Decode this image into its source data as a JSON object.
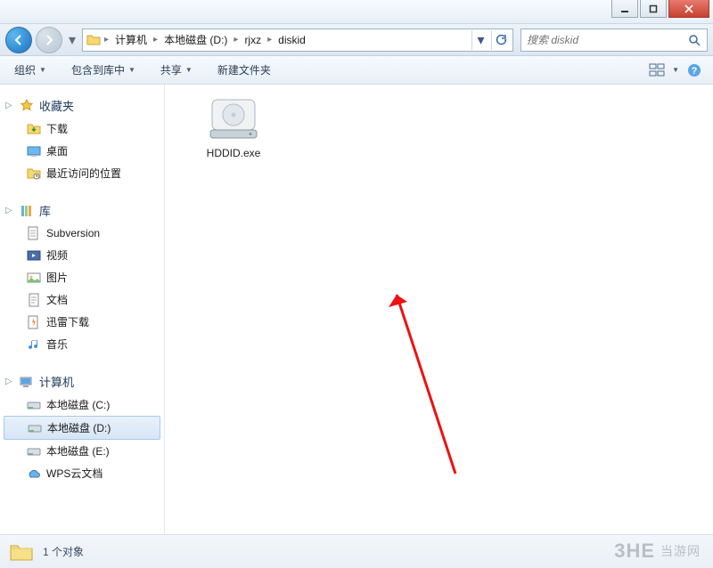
{
  "windowControls": {
    "min": "–",
    "max": "▢",
    "close": "×"
  },
  "breadcrumb": {
    "root_icon": "computer",
    "items": [
      "计算机",
      "本地磁盘 (D:)",
      "rjxz",
      "diskid"
    ]
  },
  "search": {
    "placeholder": "搜索 diskid"
  },
  "toolbar": {
    "organize": "组织",
    "include": "包含到库中",
    "share": "共享",
    "newfolder": "新建文件夹"
  },
  "sidebar": {
    "favorites": {
      "label": "收藏夹",
      "items": [
        {
          "icon": "download",
          "label": "下载"
        },
        {
          "icon": "desktop",
          "label": "桌面"
        },
        {
          "icon": "recent",
          "label": "最近访问的位置"
        }
      ]
    },
    "libraries": {
      "label": "库",
      "items": [
        {
          "icon": "svn",
          "label": "Subversion"
        },
        {
          "icon": "video",
          "label": "视频"
        },
        {
          "icon": "pictures",
          "label": "图片"
        },
        {
          "icon": "documents",
          "label": "文档"
        },
        {
          "icon": "thunder",
          "label": "迅雷下载"
        },
        {
          "icon": "music",
          "label": "音乐"
        }
      ]
    },
    "computer": {
      "label": "计算机",
      "items": [
        {
          "icon": "drive",
          "label": "本地磁盘 (C:)"
        },
        {
          "icon": "drive",
          "label": "本地磁盘 (D:)",
          "selected": true
        },
        {
          "icon": "drive",
          "label": "本地磁盘 (E:)"
        },
        {
          "icon": "wps",
          "label": "WPS云文档"
        }
      ]
    }
  },
  "file": {
    "name": "HDDID.exe"
  },
  "status": {
    "count": "1 个对象"
  },
  "watermark": {
    "logo": "3HE",
    "text": "当游网"
  }
}
